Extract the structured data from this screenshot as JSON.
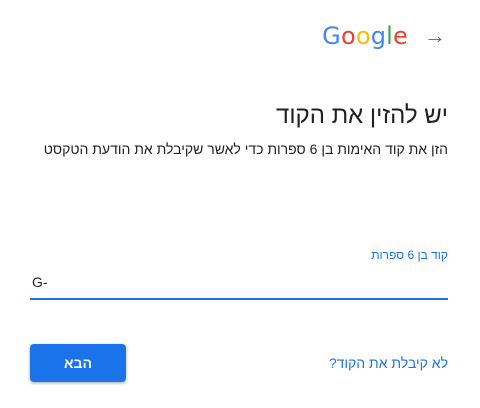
{
  "header": {
    "logo_letters": [
      {
        "char": "G",
        "color": "#4285f4"
      },
      {
        "char": "o",
        "color": "#ea4335"
      },
      {
        "char": "o",
        "color": "#fbbc05"
      },
      {
        "char": "g",
        "color": "#4285f4"
      },
      {
        "char": "l",
        "color": "#34a853"
      },
      {
        "char": "e",
        "color": "#ea4335"
      }
    ],
    "back_icon": "arrow-right-icon",
    "back_glyph": "→"
  },
  "main": {
    "title": "יש להזין את הקוד",
    "subtitle": "הזן את קוד האימות בן 6 ספרות כדי לאשר שקיבלת את הודעת הטקסט"
  },
  "code_field": {
    "label": "קוד בן 6 ספרות",
    "value": "G-"
  },
  "footer": {
    "resend_link": "לא קיבלת את הקוד?",
    "next_button": "הבא"
  },
  "colors": {
    "accent": "#1a73e8",
    "text": "#202124"
  }
}
